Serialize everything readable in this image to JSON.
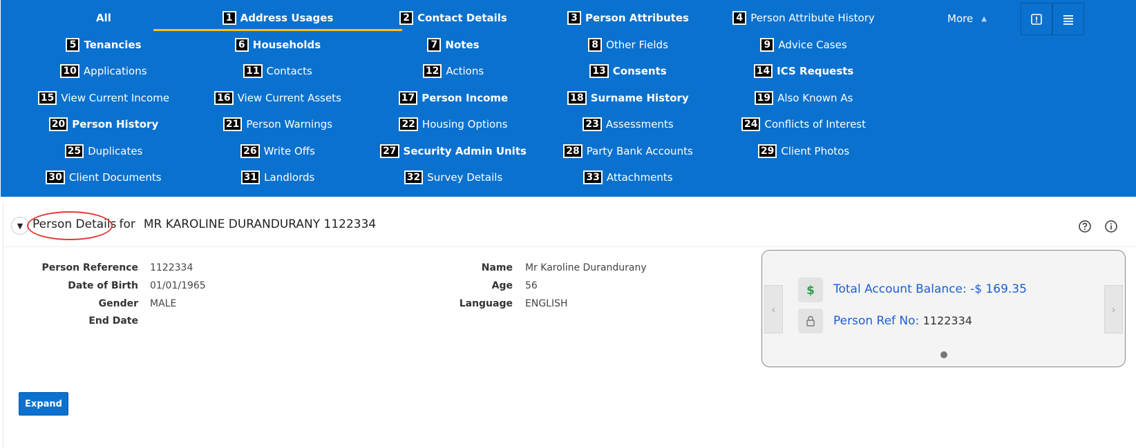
{
  "tabs": [
    {
      "num": "",
      "label": "All",
      "bold": true
    },
    {
      "num": "1",
      "label": "Address Usages",
      "bold": true
    },
    {
      "num": "2",
      "label": "Contact Details",
      "bold": true
    },
    {
      "num": "3",
      "label": "Person Attributes",
      "bold": true
    },
    {
      "num": "4",
      "label": "Person Attribute History",
      "bold": false
    },
    {
      "num": "5",
      "label": "Tenancies",
      "bold": true
    },
    {
      "num": "6",
      "label": "Households",
      "bold": true
    },
    {
      "num": "7",
      "label": "Notes",
      "bold": true
    },
    {
      "num": "8",
      "label": "Other Fields",
      "bold": false
    },
    {
      "num": "9",
      "label": "Advice Cases",
      "bold": false
    },
    {
      "num": "10",
      "label": "Applications",
      "bold": false
    },
    {
      "num": "11",
      "label": "Contacts",
      "bold": false
    },
    {
      "num": "12",
      "label": "Actions",
      "bold": false
    },
    {
      "num": "13",
      "label": "Consents",
      "bold": true
    },
    {
      "num": "14",
      "label": "ICS Requests",
      "bold": true
    },
    {
      "num": "15",
      "label": "View Current Income",
      "bold": false
    },
    {
      "num": "16",
      "label": "View Current Assets",
      "bold": false
    },
    {
      "num": "17",
      "label": "Person Income",
      "bold": true
    },
    {
      "num": "18",
      "label": "Surname History",
      "bold": true
    },
    {
      "num": "19",
      "label": "Also Known As",
      "bold": false
    },
    {
      "num": "20",
      "label": "Person History",
      "bold": true
    },
    {
      "num": "21",
      "label": "Person Warnings",
      "bold": false
    },
    {
      "num": "22",
      "label": "Housing Options",
      "bold": false
    },
    {
      "num": "23",
      "label": "Assessments",
      "bold": false
    },
    {
      "num": "24",
      "label": "Conflicts of Interest",
      "bold": false
    },
    {
      "num": "25",
      "label": "Duplicates",
      "bold": false
    },
    {
      "num": "26",
      "label": "Write Offs",
      "bold": false
    },
    {
      "num": "27",
      "label": "Security Admin Units",
      "bold": true
    },
    {
      "num": "28",
      "label": "Party Bank Accounts",
      "bold": false
    },
    {
      "num": "29",
      "label": "Client Photos",
      "bold": false
    },
    {
      "num": "30",
      "label": "Client Documents",
      "bold": false
    },
    {
      "num": "31",
      "label": "Landlords",
      "bold": false
    },
    {
      "num": "32",
      "label": "Survey Details",
      "bold": false
    },
    {
      "num": "33",
      "label": "Attachments",
      "bold": false
    }
  ],
  "active_tab": "Address Usages",
  "more_label": "More",
  "toolbar_icons": [
    "alert-icon",
    "menu-icon"
  ],
  "region": {
    "title": "Person Details",
    "for_text": "for",
    "person_name": "MR KAROLINE DURANDURANY 1122334",
    "fields_left": [
      {
        "label": "Person Reference",
        "value": "1122334"
      },
      {
        "label": "Date of Birth",
        "value": "01/01/1965"
      },
      {
        "label": "Gender",
        "value": "MALE"
      },
      {
        "label": "End Date",
        "value": ""
      }
    ],
    "fields_right": [
      {
        "label": "Name",
        "value": "Mr Karoline Durandurany"
      },
      {
        "label": "Age",
        "value": "56"
      },
      {
        "label": "Language",
        "value": "ENGLISH"
      }
    ]
  },
  "card": {
    "balance_label": "Total Account Balance:",
    "balance_value": "-$ 169.35",
    "ref_label": "Person Ref No:",
    "ref_value": "1122334",
    "prev_arrow": "‹",
    "next_arrow": "›"
  },
  "expand_label": "Expand",
  "colors": {
    "primary": "#0a71cf",
    "active_indicator": "#f5c518",
    "highlight": "#e53935",
    "dollar_icon": "#2e9e4f"
  }
}
